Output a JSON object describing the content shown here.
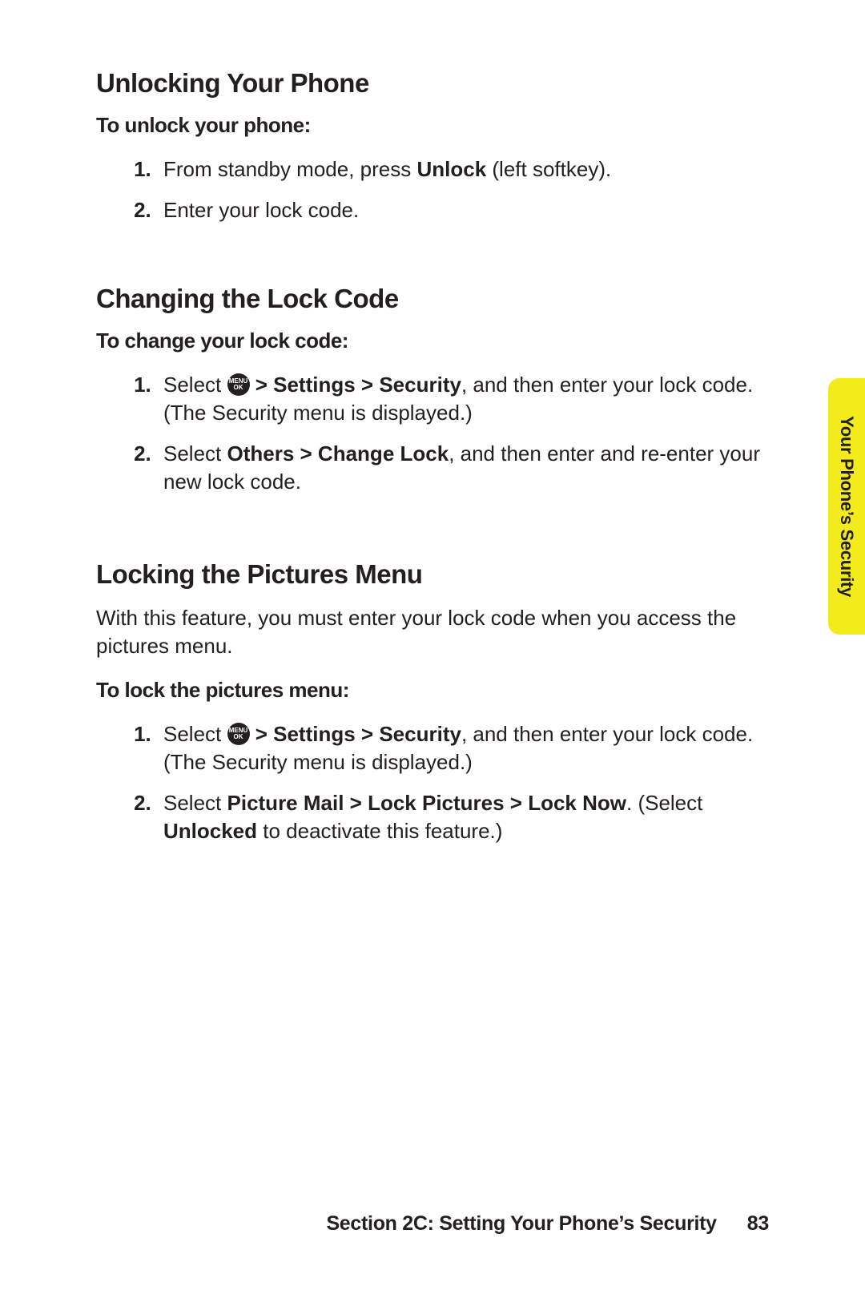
{
  "sections": {
    "unlock": {
      "heading": "Unlocking Your Phone",
      "sub": "To unlock your phone:",
      "step1_pre": "From standby mode, press ",
      "step1_bold": "Unlock",
      "step1_post": " (left softkey).",
      "step2": "Enter your lock code."
    },
    "change": {
      "heading": "Changing the Lock Code",
      "sub": "To change your lock code:",
      "step1_pre": "Select ",
      "step1_bold": " > Settings > Security",
      "step1_post": ", and then enter your lock code. (The Security menu is displayed.)",
      "step2_pre": "Select ",
      "step2_bold": "Others > Change Lock",
      "step2_post": ", and then enter and re-enter your new lock code."
    },
    "pictures": {
      "heading": "Locking the Pictures Menu",
      "body": "With this feature, you must enter your lock code when you access the pictures menu.",
      "sub": "To lock the pictures menu:",
      "step1_pre": "Select ",
      "step1_bold": " > Settings > Security",
      "step1_post": ", and then enter your lock code. (The Security menu is displayed.)",
      "step2_pre": "Select ",
      "step2_bold": "Picture Mail > Lock Pictures > Lock Now",
      "step2_mid": ". (Select ",
      "step2_bold2": "Unlocked",
      "step2_post": " to deactivate this feature.)"
    }
  },
  "menu_button": {
    "line1": "MENU",
    "line2": "OK"
  },
  "tab": "Your Phone’s Security",
  "footer": {
    "section": "Section 2C: Setting Your Phone’s Security",
    "page": "83"
  }
}
